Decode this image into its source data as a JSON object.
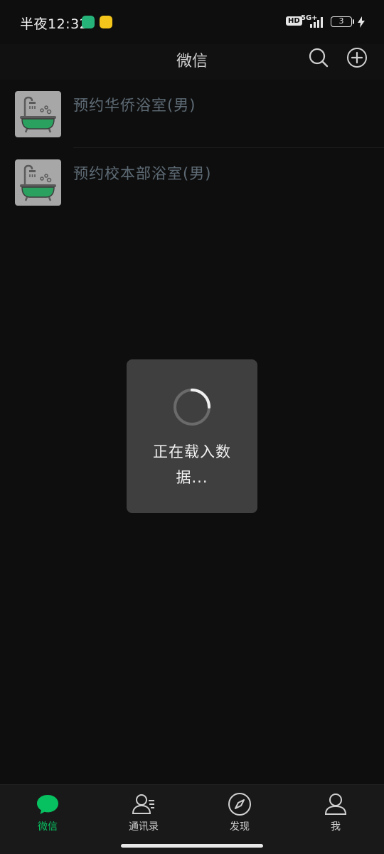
{
  "status_bar": {
    "time": "半夜12:32",
    "hd": "HD",
    "network": "5G+",
    "battery": "3"
  },
  "nav": {
    "title": "微信"
  },
  "list": {
    "items": [
      {
        "label": "预约华侨浴室(男)",
        "icon": "bathtub-icon"
      },
      {
        "label": "预约校本部浴室(男)",
        "icon": "bathtub-icon"
      }
    ]
  },
  "loading": {
    "line1": "正在载入数",
    "line2": "据..."
  },
  "tabs": [
    {
      "label": "微信",
      "icon": "chat-bubble-icon",
      "active": true
    },
    {
      "label": "通讯录",
      "icon": "contacts-icon",
      "active": false
    },
    {
      "label": "发现",
      "icon": "compass-icon",
      "active": false
    },
    {
      "label": "我",
      "icon": "person-icon",
      "active": false
    }
  ],
  "colors": {
    "accent": "#07c160",
    "background": "#0e0e0e",
    "toast": "#3f3f3f",
    "tub": "#2aa15e"
  }
}
